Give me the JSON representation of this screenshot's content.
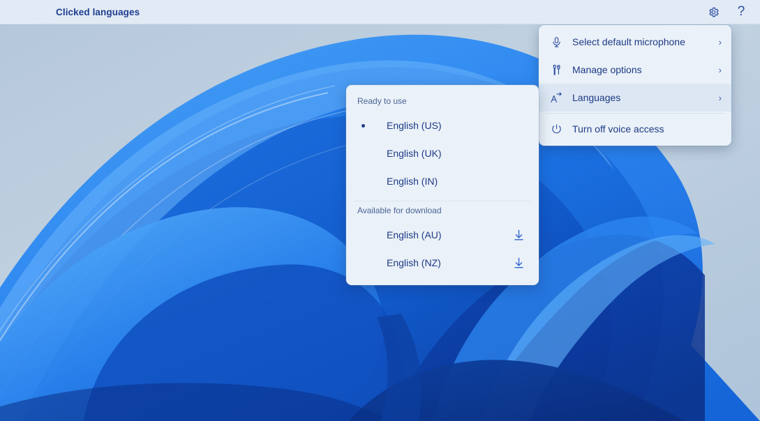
{
  "titlebar": {
    "title": "Clicked languages",
    "settings_icon": "gear-icon",
    "help_label": "?"
  },
  "context_menu": {
    "items": [
      {
        "icon": "microphone-icon",
        "label": "Select default microphone",
        "chevron": "›",
        "selected": false
      },
      {
        "icon": "tools-icon",
        "label": "Manage options",
        "chevron": "›",
        "selected": false
      },
      {
        "icon": "translate-icon",
        "label": "Languages",
        "chevron": "›",
        "selected": true
      },
      {
        "icon": "power-icon",
        "label": "Turn off voice access",
        "chevron": "",
        "selected": false
      }
    ]
  },
  "languages_panel": {
    "section_ready": "Ready to use",
    "section_download": "Available for download",
    "ready_items": [
      {
        "label": "English (US)",
        "selected": true
      },
      {
        "label": "English (UK)",
        "selected": false
      },
      {
        "label": "English (IN)",
        "selected": false
      }
    ],
    "download_items": [
      {
        "label": "English (AU)",
        "action_icon": "download-icon"
      },
      {
        "label": "English (NZ)",
        "action_icon": "download-icon"
      }
    ]
  },
  "colors": {
    "titlebar_bg": "#e2ebf5",
    "panel_bg": "#eaf1f8",
    "accent_text": "#1e3a85",
    "selected_row_bg": "#dce7f3",
    "download_icon": "#2f62cf"
  }
}
